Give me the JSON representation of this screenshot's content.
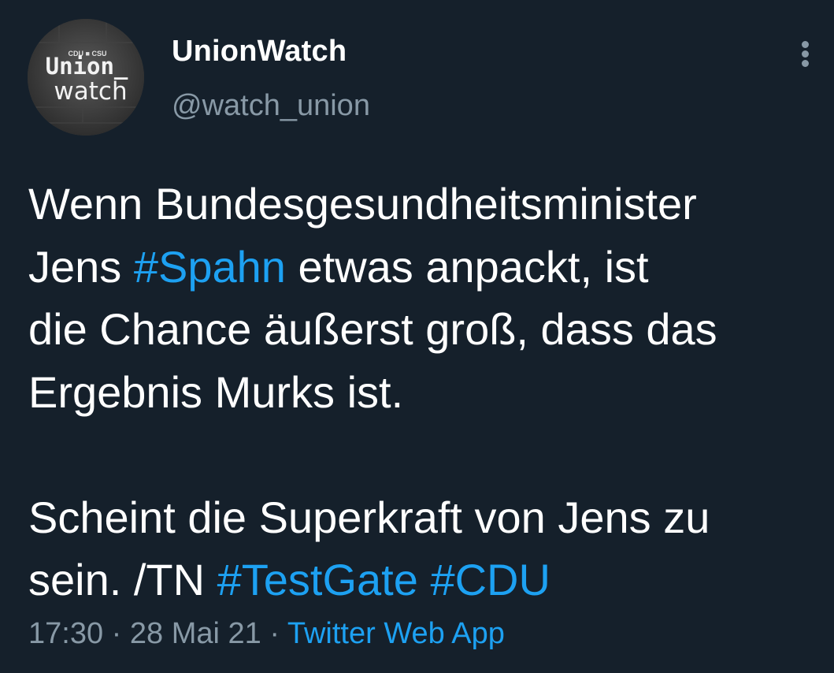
{
  "author": {
    "display_name": "UnionWatch",
    "handle": "@watch_union",
    "avatar": {
      "small_text": "CDU ■ CSU",
      "line1": "Union_",
      "line2": "watch"
    }
  },
  "more_icon": "vertical-ellipsis-icon",
  "tweet": {
    "line1": "Wenn Bundesgesundheitsminister",
    "line2_pre": "Jens ",
    "line2_tag": "#Spahn",
    "line2_post": " etwas anpackt, ist",
    "line3": "die Chance äußerst groß, dass das",
    "line4": "Ergebnis Murks ist.",
    "line5": "Scheint die Superkraft von Jens zu",
    "line6_pre": "sein. /TN ",
    "line6_tag1": "#TestGate",
    "line6_tag2": "#CDU"
  },
  "meta": {
    "time": "17:30",
    "separator": " · ",
    "date": "28 Mai 21",
    "source": "Twitter Web App"
  },
  "colors": {
    "background": "#15202b",
    "text": "#ffffff",
    "secondary": "#8899a6",
    "accent": "#1da1f2"
  }
}
